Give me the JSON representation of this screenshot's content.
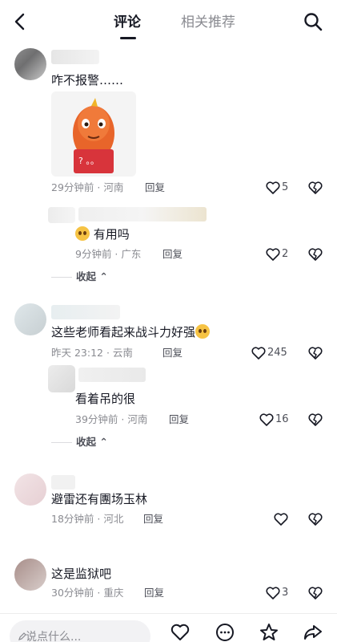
{
  "header": {
    "tabs": [
      {
        "label": "评论",
        "active": true
      },
      {
        "label": "相关推荐",
        "active": false
      }
    ]
  },
  "comments": [
    {
      "text": "咋不报警……",
      "time": "29分钟前",
      "location": "河南",
      "reply_label": "回复",
      "likes": "5",
      "sticker_text": "? 。。"
    },
    {
      "text": "有用吗",
      "time": "9分钟前",
      "location": "广东",
      "reply_label": "回复",
      "likes": "2"
    },
    {
      "text": "这些老师看起来战斗力好强",
      "time": "昨天 23:12",
      "location": "云南",
      "reply_label": "回复",
      "likes": "245"
    },
    {
      "text": "看着吊的很",
      "time": "39分钟前",
      "location": "河南",
      "reply_label": "回复",
      "likes": "16"
    },
    {
      "text": "避雷还有團场玉林",
      "time": "18分钟前",
      "location": "河北",
      "reply_label": "回复",
      "likes": ""
    },
    {
      "text": "这是监狱吧",
      "time": "30分钟前",
      "location": "重庆",
      "reply_label": "回复",
      "likes": "3"
    }
  ],
  "collapse_label": "收起",
  "bottom": {
    "input_placeholder": "说点什么...",
    "icons": [
      "heart-icon",
      "comment-icon",
      "star-icon",
      "share-icon"
    ]
  },
  "colors": {
    "text_primary": "#161823",
    "text_secondary": "#8a8b91",
    "sticker_orange": "#e8652a",
    "sticker_red": "#d8343b"
  }
}
